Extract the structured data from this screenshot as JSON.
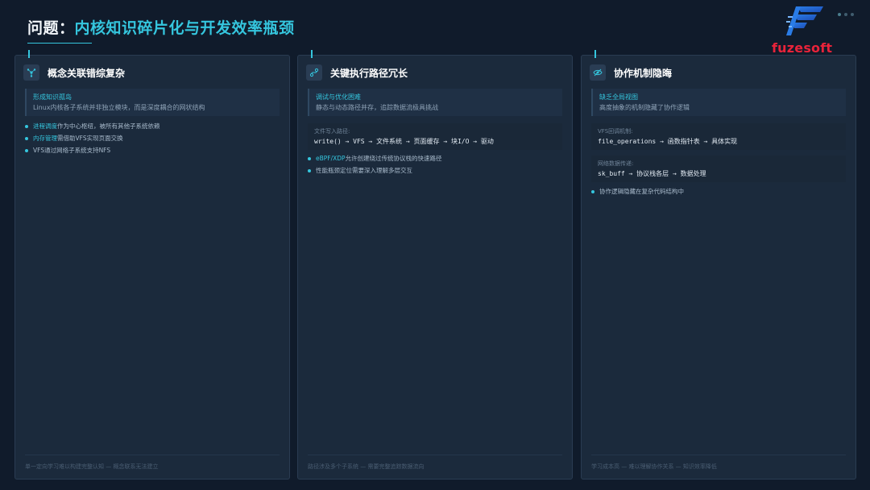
{
  "title": {
    "prefix": "问题：",
    "highlight": "内核知识碎片化与开发效率瓶颈"
  },
  "logo": {
    "text": "fuzesoft"
  },
  "colors": {
    "accent": "#35c6de",
    "logo_red": "#e8233a",
    "background": "#101b2b",
    "card": "#1b2a3c"
  },
  "cards": [
    {
      "icon": "network-icon",
      "title": "概念关联错综复杂",
      "subpanel": {
        "head": "形成知识孤岛",
        "body": "Linux内核各子系统并非独立模块，而是深度耦合的网状结构"
      },
      "bullets": [
        {
          "kw": "进程调度",
          "text": "作为中心枢纽，被所有其他子系统依赖"
        },
        {
          "kw": "内存管理",
          "text": "需借助VFS实现页面交换"
        },
        {
          "kw": "",
          "text": "VFS通过网络子系统支持NFS"
        }
      ],
      "footer": "单一定向学习难以构建完整认知 — 概念联系无法建立"
    },
    {
      "icon": "path-icon",
      "title": "关键执行路径冗长",
      "subpanel": {
        "head": "调试与优化困难",
        "body": "静态与动态路径并存，追踪数据流极具挑战"
      },
      "codeboxes": [
        {
          "label": "文件写入路径:",
          "path": "write() → VFS → 文件系统 → 页面缓存 → 块I/O → 驱动"
        }
      ],
      "bullets": [
        {
          "kw": "eBPF/XDP",
          "text": "允许创建绕过传统协议栈的快速路径"
        },
        {
          "kw": "",
          "text": "性能瓶颈定位需要深入理解多层交互"
        }
      ],
      "footer": "路径涉及多个子系统 — 需要完整追踪数据流向"
    },
    {
      "icon": "eye-off-icon",
      "title": "协作机制隐晦",
      "subpanel": {
        "head": "缺乏全局视图",
        "body": "高度抽象的机制隐藏了协作逻辑"
      },
      "codeboxes": [
        {
          "label": "VFS回调机制:",
          "path": "file_operations → 函数指针表 → 具体实现"
        },
        {
          "label": "网络数据传递:",
          "path": "sk_buff → 协议栈各层 → 数据处理"
        }
      ],
      "bullets": [
        {
          "kw": "",
          "text": "协作逻辑隐藏在复杂代码结构中"
        }
      ],
      "footer": "学习成本高 — 难以理解协作关系 — 知识效率降低"
    }
  ]
}
